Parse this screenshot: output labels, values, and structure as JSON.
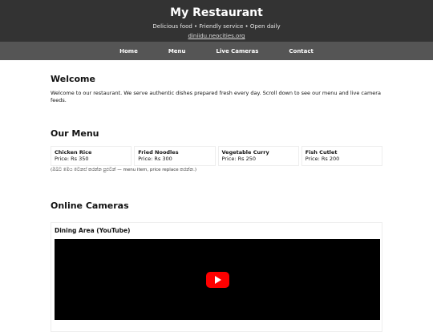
{
  "header": {
    "title": "My Restaurant",
    "tagline": "Delicious food • Friendly service • Open daily",
    "link": "diniidu.neocities.org"
  },
  "nav": {
    "items": [
      "Home",
      "Menu",
      "Live Cameras",
      "Contact"
    ]
  },
  "welcome": {
    "heading": "Welcome",
    "text": "Welcome to our restaurant. We serve authentic dishes prepared fresh every day. Scroll down to see our menu and live camera feeds."
  },
  "menu": {
    "heading": "Our Menu",
    "items": [
      {
        "name": "Chicken Rice",
        "price": "Price: Rs 350"
      },
      {
        "name": "Fried Noodles",
        "price": "Price: Rs 300"
      },
      {
        "name": "Vegetable Curry",
        "price": "Price: Rs 250"
      },
      {
        "name": "Fish Cutlet",
        "price": "Price: Rs 200"
      }
    ],
    "note": "(ඔබට මෙය වෙනස් කරන්න පුළුවන් — menu item, price replace කරන්න.)"
  },
  "cameras": {
    "heading": "Online Cameras",
    "feeds": [
      {
        "title": "Dining Area (YouTube)"
      }
    ]
  },
  "colors": {
    "header_bg": "#333333",
    "nav_bg": "#555555",
    "play_button": "#ff0000"
  }
}
